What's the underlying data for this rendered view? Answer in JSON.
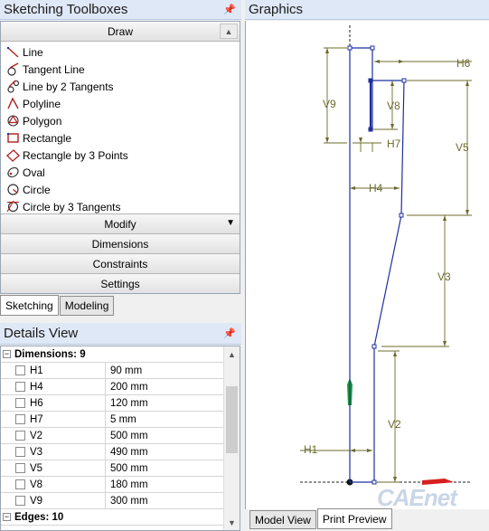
{
  "toolboxes": {
    "title": "Sketching Toolboxes",
    "pin": "⬆",
    "draw_header": "Draw",
    "draw_items": [
      {
        "label": "Line",
        "icon": "line-icon"
      },
      {
        "label": "Tangent Line",
        "icon": "tangent-line-icon"
      },
      {
        "label": "Line by 2 Tangents",
        "icon": "line-2-tangents-icon"
      },
      {
        "label": "Polyline",
        "icon": "polyline-icon"
      },
      {
        "label": "Polygon",
        "icon": "polygon-icon"
      },
      {
        "label": "Rectangle",
        "icon": "rectangle-icon"
      },
      {
        "label": "Rectangle by 3 Points",
        "icon": "rectangle-3pt-icon"
      },
      {
        "label": "Oval",
        "icon": "oval-icon"
      },
      {
        "label": "Circle",
        "icon": "circle-icon"
      },
      {
        "label": "Circle by 3 Tangents",
        "icon": "circle-3-tangents-icon"
      }
    ],
    "sections": [
      "Modify",
      "Dimensions",
      "Constraints",
      "Settings"
    ],
    "tabs": [
      "Sketching",
      "Modeling"
    ]
  },
  "details": {
    "title": "Details View",
    "group_dimensions": "Dimensions: 9",
    "rows": [
      {
        "name": "H1",
        "value": "90 mm"
      },
      {
        "name": "H4",
        "value": "200 mm"
      },
      {
        "name": "H6",
        "value": "120 mm"
      },
      {
        "name": "H7",
        "value": "5 mm"
      },
      {
        "name": "V2",
        "value": "500 mm"
      },
      {
        "name": "V3",
        "value": "490 mm"
      },
      {
        "name": "V5",
        "value": "500 mm"
      },
      {
        "name": "V8",
        "value": "180 mm"
      },
      {
        "name": "V9",
        "value": "300 mm"
      }
    ],
    "group_edges": "Edges: 10"
  },
  "graphics": {
    "title": "Graphics",
    "labels": {
      "H6": "H6",
      "V9": "V9",
      "V8": "V8",
      "V5": "V5",
      "H7": "H7",
      "H4": "H4",
      "V3": "V3",
      "V2": "V2",
      "H1": "H1"
    },
    "tabs": [
      "Model View",
      "Print Preview"
    ],
    "watermark": "CAEnet"
  },
  "colors": {
    "sketch": "#1f2fa0",
    "dimension": "#6b6b2e",
    "axis_green": "#1a9e2a",
    "axis_red": "#d62020",
    "title_bar": "#dfe8f6"
  }
}
